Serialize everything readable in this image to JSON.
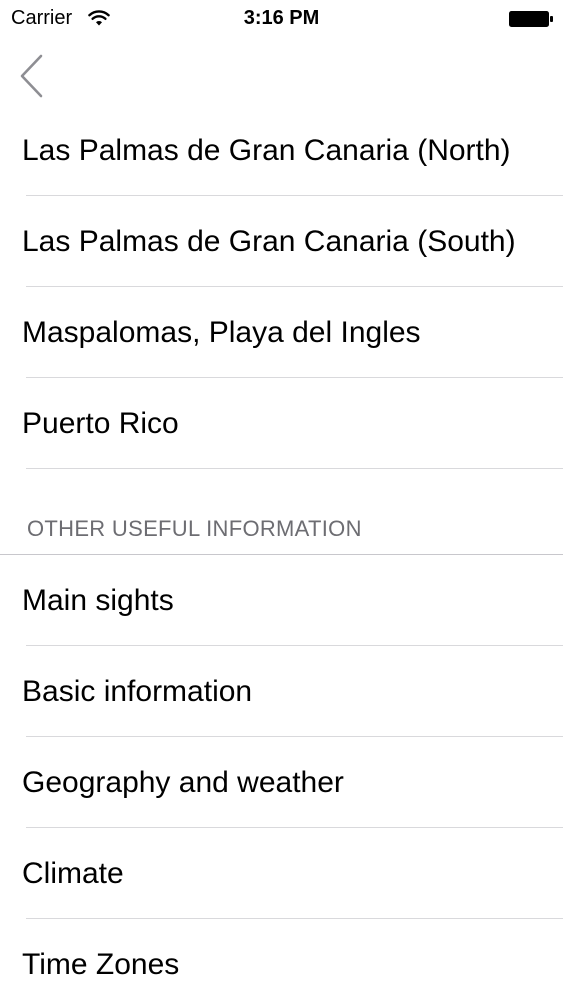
{
  "status_bar": {
    "carrier": "Carrier",
    "time": "3:16 PM",
    "icons": [
      "wifi-icon",
      "battery-icon"
    ]
  },
  "nav": {
    "back_icon": "chevron-left-icon"
  },
  "list": {
    "section1_items": [
      "Las Palmas de Gran Canaria (North)",
      "Las Palmas de Gran Canaria (South)",
      "Maspalomas, Playa del Ingles",
      "Puerto Rico"
    ],
    "section2_header": "OTHER USEFUL INFORMATION",
    "section2_items": [
      "Main sights",
      "Basic information",
      "Geography and weather",
      "Climate",
      "Time Zones"
    ]
  },
  "colors": {
    "separator": "#d9d9dc",
    "section_header_text": "#6d6d72",
    "back_chevron": "#8e8e93"
  }
}
